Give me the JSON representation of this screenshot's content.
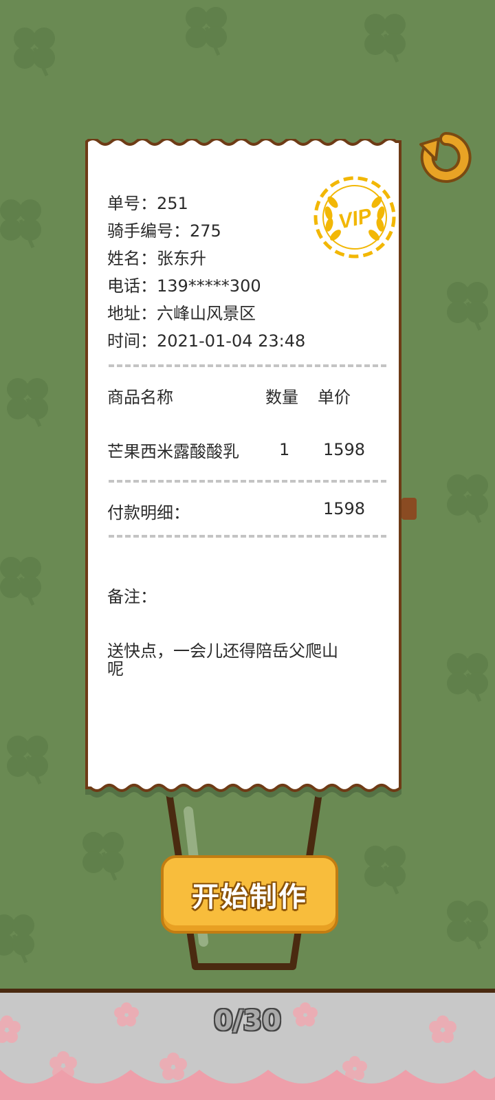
{
  "order": {
    "number_label": "单号：",
    "number": "251",
    "rider_label": "骑手编号：",
    "rider": "275",
    "name_label": "姓名：",
    "name": "张东升",
    "phone_label": "电话：",
    "phone": "139*****300",
    "address_label": "地址：",
    "address": "六峰山风景区",
    "time_label": "时间：",
    "time": "2021-01-04 23:48"
  },
  "vip_badge": "VIP",
  "table": {
    "headers": [
      "商品名称",
      "数量",
      "单价"
    ],
    "rows": [
      {
        "name": "芒果西米露酸酸乳",
        "qty": "1",
        "price": "1598"
      }
    ]
  },
  "payment": {
    "label": "付款明细：",
    "amount": "1598"
  },
  "remark": {
    "label": "备注：",
    "text_line1": "送快点，一会儿还得陪岳父爬山",
    "text_line2": "呢"
  },
  "start_button_label": "开始制作",
  "progress": {
    "text": "0/30",
    "current": 0,
    "total": 30
  },
  "icons": {
    "restart": "restart-arrow-icon",
    "vip": "vip-stamp-icon"
  },
  "colors": {
    "background": "#6a8a53",
    "receipt_border": "#6e3b14",
    "button": "#f8bd3c",
    "vip_gold": "#f2b705",
    "bottom_pink": "#ee9faa"
  }
}
